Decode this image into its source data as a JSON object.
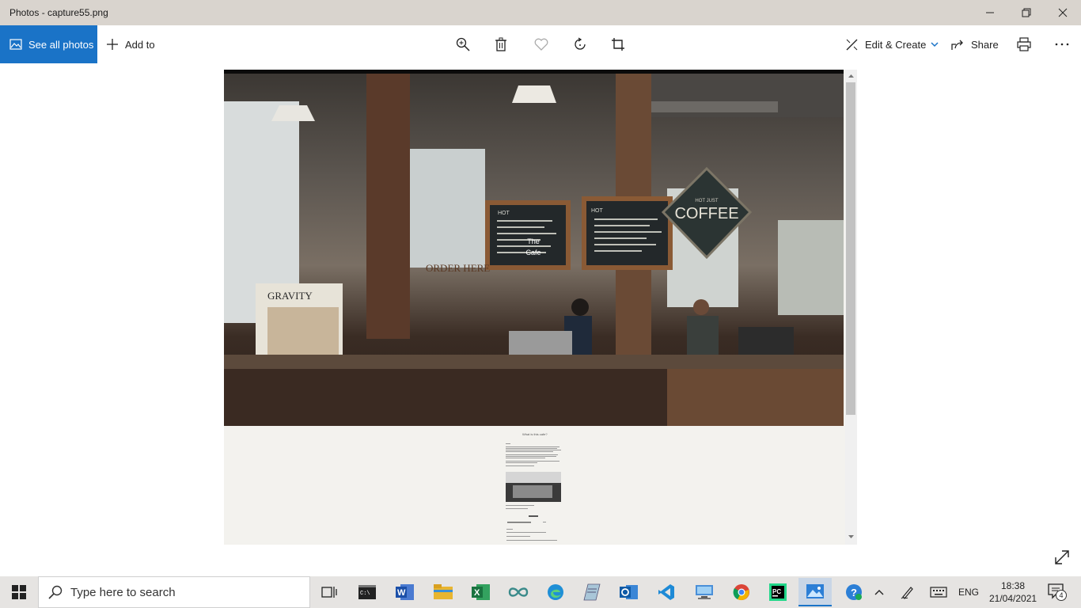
{
  "window": {
    "title": "Photos - capture55.png"
  },
  "toolbar": {
    "see_all_label": "See all photos",
    "add_to_label": "Add to",
    "edit_create_label": "Edit & Create",
    "share_label": "Share"
  },
  "photo": {
    "sign_coffee": "COFFEE",
    "sign_hot_just": "HOT JUST",
    "sign_order_here": "ORDER HERE",
    "sign_gravity": "GRAVITY",
    "overlay_title_line1": "The",
    "overlay_title_line2": "Cafe"
  },
  "document": {
    "heading": "What is this cafe?"
  },
  "taskbar": {
    "search_placeholder": "Type here to search",
    "language": "ENG",
    "time": "18:38",
    "date": "21/04/2021",
    "notification_count": "4"
  }
}
